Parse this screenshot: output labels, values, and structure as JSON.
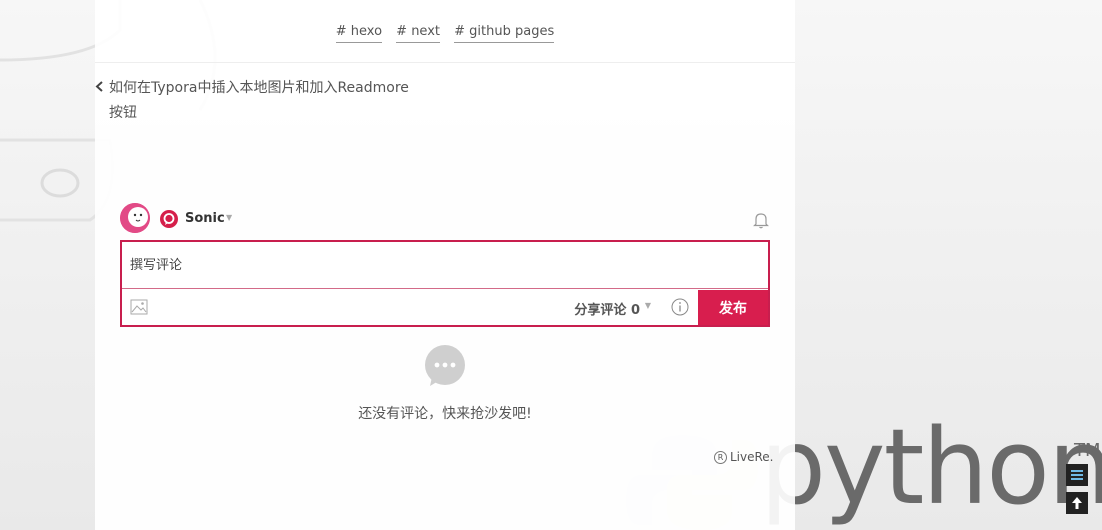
{
  "tags": [
    "# hexo",
    "# next",
    "# github pages"
  ],
  "prev_post": {
    "title_line1": "如何在Typora中插入本地图片和加入Readmore",
    "title_line2": "按钮"
  },
  "comment": {
    "username": "Sonic",
    "placeholder": "撰写评论",
    "share_label": "分享评论 0",
    "publish_label": "发布",
    "empty_message": "还没有评论，快来抢沙发吧!",
    "credit": "LiveRe."
  },
  "background": {
    "python_wordmark": "python",
    "trademark": "TM"
  },
  "colors": {
    "accent": "#d81e4e",
    "text": "#555555"
  }
}
